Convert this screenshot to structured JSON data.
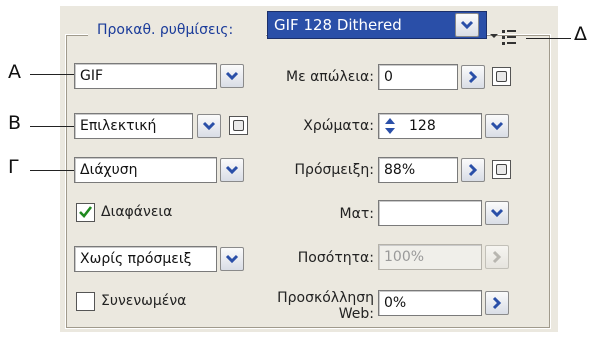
{
  "callouts": {
    "a": "A",
    "b": "B",
    "g": "Γ",
    "d": "Δ"
  },
  "preset": {
    "label": "Προκαθ. ρυθμίσεις:",
    "value": "GIF 128 Dithered"
  },
  "format": {
    "value": "GIF"
  },
  "reduction": {
    "value": "Επιλεκτική"
  },
  "dither_algorithm": {
    "value": "Διάχυση"
  },
  "transparency": {
    "label": "Διαφάνεια",
    "checked": true
  },
  "transparency_dither": {
    "value": "Χωρίς πρόσμειξ"
  },
  "interlaced": {
    "label": "Συνενωμένα",
    "checked": false
  },
  "lossy": {
    "label": "Με απώλεια:",
    "value": "0"
  },
  "colors": {
    "label": "Χρώματα:",
    "value": "128"
  },
  "dither": {
    "label": "Πρόσμειξη:",
    "value": "88%"
  },
  "matte": {
    "label": "Ματ:",
    "value": ""
  },
  "amount": {
    "label": "Ποσότητα:",
    "value": "100%"
  },
  "web_snap": {
    "label_line1": "Προσκόλληση",
    "label_line2": "Web:",
    "value": "0%"
  }
}
